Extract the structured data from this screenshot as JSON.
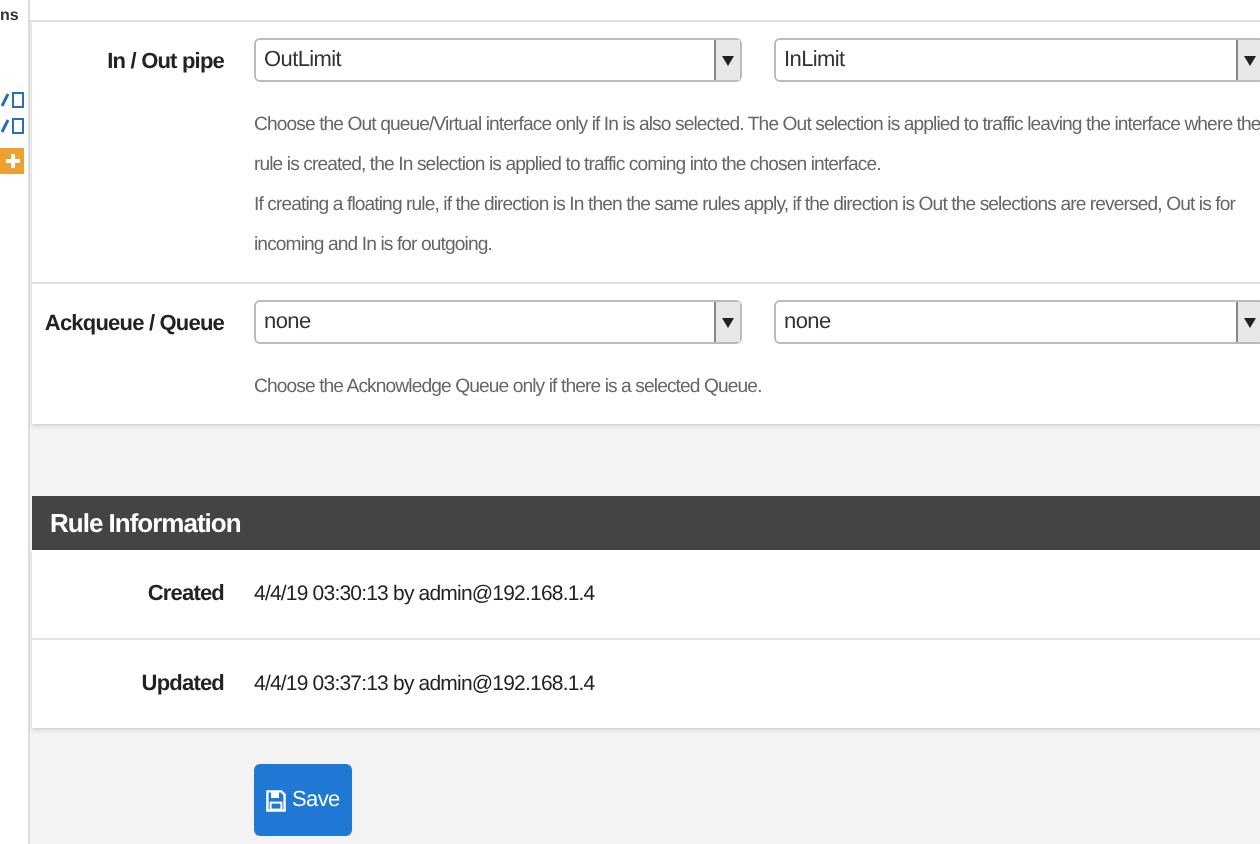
{
  "side_strip": {
    "label": "ns"
  },
  "form": {
    "rows": [
      {
        "label": "In / Out pipe",
        "selects": [
          "OutLimit",
          "InLimit"
        ],
        "help": [
          "Choose the Out queue/Virtual interface only if In is also selected. The Out selection is applied to traffic leaving the interface where the rule is created, the In selection is applied to traffic coming into the chosen interface.",
          "If creating a floating rule, if the direction is In then the same rules apply, if the direction is Out the selections are reversed, Out is for incoming and In is for outgoing."
        ]
      },
      {
        "label": "Ackqueue / Queue",
        "selects": [
          "none",
          "none"
        ],
        "help": [
          "Choose the Acknowledge Queue only if there is a selected Queue."
        ]
      }
    ]
  },
  "rule_information": {
    "title": "Rule Information",
    "rows": [
      {
        "label": "Created",
        "value": "4/4/19 03:30:13 by admin@192.168.1.4"
      },
      {
        "label": "Updated",
        "value": "4/4/19 03:37:13 by admin@192.168.1.4"
      }
    ]
  },
  "save_button": {
    "label": "Save"
  }
}
